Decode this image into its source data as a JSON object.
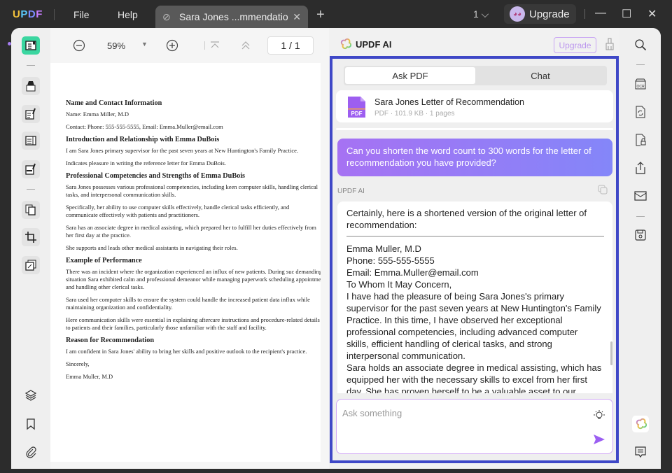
{
  "titlebar": {
    "logo": [
      "U",
      "P",
      "D",
      "F"
    ],
    "menu": {
      "file": "File",
      "help": "Help"
    },
    "tab_title": "Sara Jones ...mmendation*",
    "tab_close": "✕",
    "new_tab": "+",
    "page_count": "1 ⌵",
    "upgrade_label": "Upgrade",
    "window": {
      "minimize": "—",
      "maximize": "☐",
      "close": "✕"
    }
  },
  "toolbar": {
    "zoom": "59%",
    "zoom_dropdown": "▼",
    "page_indicator": "1 / 1"
  },
  "document": {
    "sections": [
      {
        "heading": "Name and Contact Information",
        "paras": [
          "Name: Emma Miller, M.D",
          "Contact: Phone: 555-555-5555, Email: Emma.Muller@email.com"
        ]
      },
      {
        "heading": "Introduction and Relationship with Emma DuBois",
        "paras": [
          "I am Sara Jones primary supervisor for the past seven years at New Huntington's Family Practice.",
          "Indicates pleasure in writing the reference letter for Emma DuBois."
        ]
      },
      {
        "heading": "Professional Competencies and Strengths of Emma DuBois",
        "paras": [
          "Sara Jones possesses various professional competencies, including keen computer skills, handling clerical tasks, and interpersonal communication skills.",
          "Specifically, her ability to use computer skills effectively, handle clerical tasks efficiently, and communicate effectively with patients and practitioners.",
          "Sara has an associate degree in medical assisting, which prepared her to fulfill her duties effectively from her first day at the practice.",
          "She supports and leads other medical assistants in navigating their roles."
        ]
      },
      {
        "heading": "Example of Performance",
        "paras": [
          "There was an incident where the organization experienced an influx of new patients. During suc demanding situation Sara exhibited calm and professional demeanor while managing paperwork scheduling appointments, and handling other clerical tasks.",
          "Sara used her computer skills to ensure the system could handle the increased patient data influx while maintaining organization and confidentiality.",
          "Here communication skills were essential in explaining aftercare instructions and procedure-related details to patients and their families, particularly those unfamiliar with the staff and facility."
        ]
      },
      {
        "heading": "Reason for Recommendation",
        "paras": [
          "I am confident in Sara Jones' ability to bring her skills and positive outlook to the recipient's practice.",
          "Sincerely,",
          "Emma Muller, M.D"
        ]
      }
    ]
  },
  "ai": {
    "title": "UPDF AI",
    "upgrade_label": "Upgrade",
    "tabs": {
      "ask_pdf": "Ask PDF",
      "chat": "Chat"
    },
    "file": {
      "name": "Sara Jones Letter of Recommendation",
      "meta": "PDF · 101.9 KB · 1 pages",
      "badge": "PDF"
    },
    "user_message": "Can you shorten the word count to 300 words for the letter of recommendation you have provided?",
    "response_label": "UPDF AI",
    "response_intro": "Certainly, here is a shortened version of the original letter of recommendation:",
    "response_lines": [
      "Emma Muller, M.D",
      "Phone: 555-555-5555",
      "Email: Emma.Muller@email.com",
      "To Whom It May Concern,",
      "I have had the pleasure of being Sara Jones's primary",
      "supervisor for the past seven years at New Huntington's Family",
      "Practice. In this time, I have observed her exceptional",
      "professional competencies, including advanced computer",
      "skills, efficient handling of clerical tasks, and strong",
      "interpersonal communication.",
      "Sara holds an associate degree in medical assisting, which has",
      "equipped her with the necessary skills to excel from her first",
      "day. She has proven herself to be a valuable asset to our"
    ],
    "input_placeholder": "Ask something"
  },
  "colors": {
    "accent_purple": "#a672f3",
    "frame_blue": "#3f48c7",
    "active_tool_green": "#3bd6a0"
  }
}
